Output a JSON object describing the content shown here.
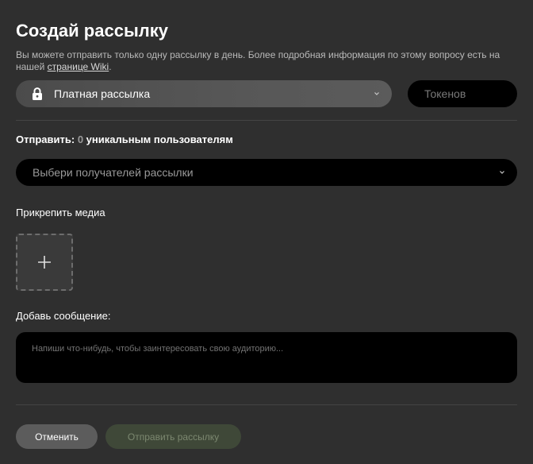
{
  "title": "Создай рассылку",
  "info": {
    "text": "Вы можете отправить только одну рассылку в день. Более подробная информация по этому вопросу есть на нашей ",
    "link": "странице Wiki",
    "end": "."
  },
  "type_select": {
    "icon": "lock-icon",
    "value": "Платная рассылка"
  },
  "tokens": {
    "placeholder": "Токенов"
  },
  "send": {
    "prefix": "Отправить:",
    "count": "0",
    "suffix": "уникальным пользователям"
  },
  "recipients": {
    "placeholder": "Выбери получателей рассылки"
  },
  "media": {
    "label": "Прикрепить медиа"
  },
  "message": {
    "label": "Добавь сообщение:",
    "placeholder": "Напиши что-нибудь, чтобы заинтересовать свою аудиторию..."
  },
  "buttons": {
    "cancel": "Отменить",
    "submit": "Отправить рассылку"
  },
  "colors": {
    "background": "#2f2f2f",
    "field_dark": "#000000",
    "submit_disabled": "#3f4838",
    "cancel": "#5c5c5c"
  }
}
